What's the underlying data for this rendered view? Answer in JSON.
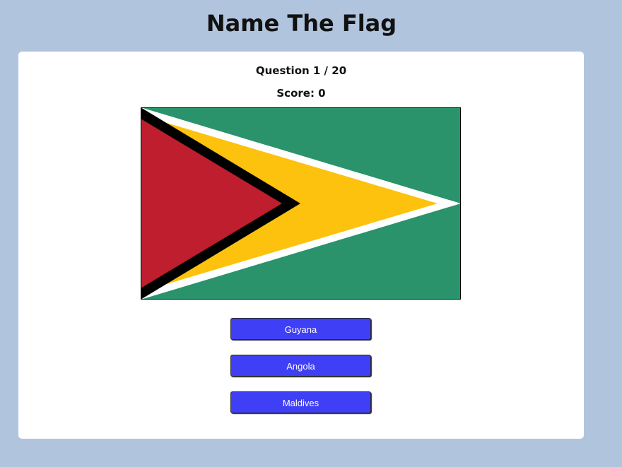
{
  "header": {
    "title": "Name The Flag"
  },
  "quiz": {
    "question_label": "Question 1 / 20",
    "score_label": "Score: 0"
  },
  "flag": {
    "icon": "guyana-flag",
    "colors": {
      "green": "#2a936b",
      "white": "#ffffff",
      "yellow": "#fdc20d",
      "black": "#000000",
      "red": "#be1e2d"
    }
  },
  "answers": [
    {
      "label": "Guyana"
    },
    {
      "label": "Angola"
    },
    {
      "label": "Maldives"
    }
  ],
  "colors": {
    "page_background": "#b0c4de",
    "card_background": "#ffffff",
    "button_background": "#3f3ff5",
    "button_text": "#ffffff"
  }
}
